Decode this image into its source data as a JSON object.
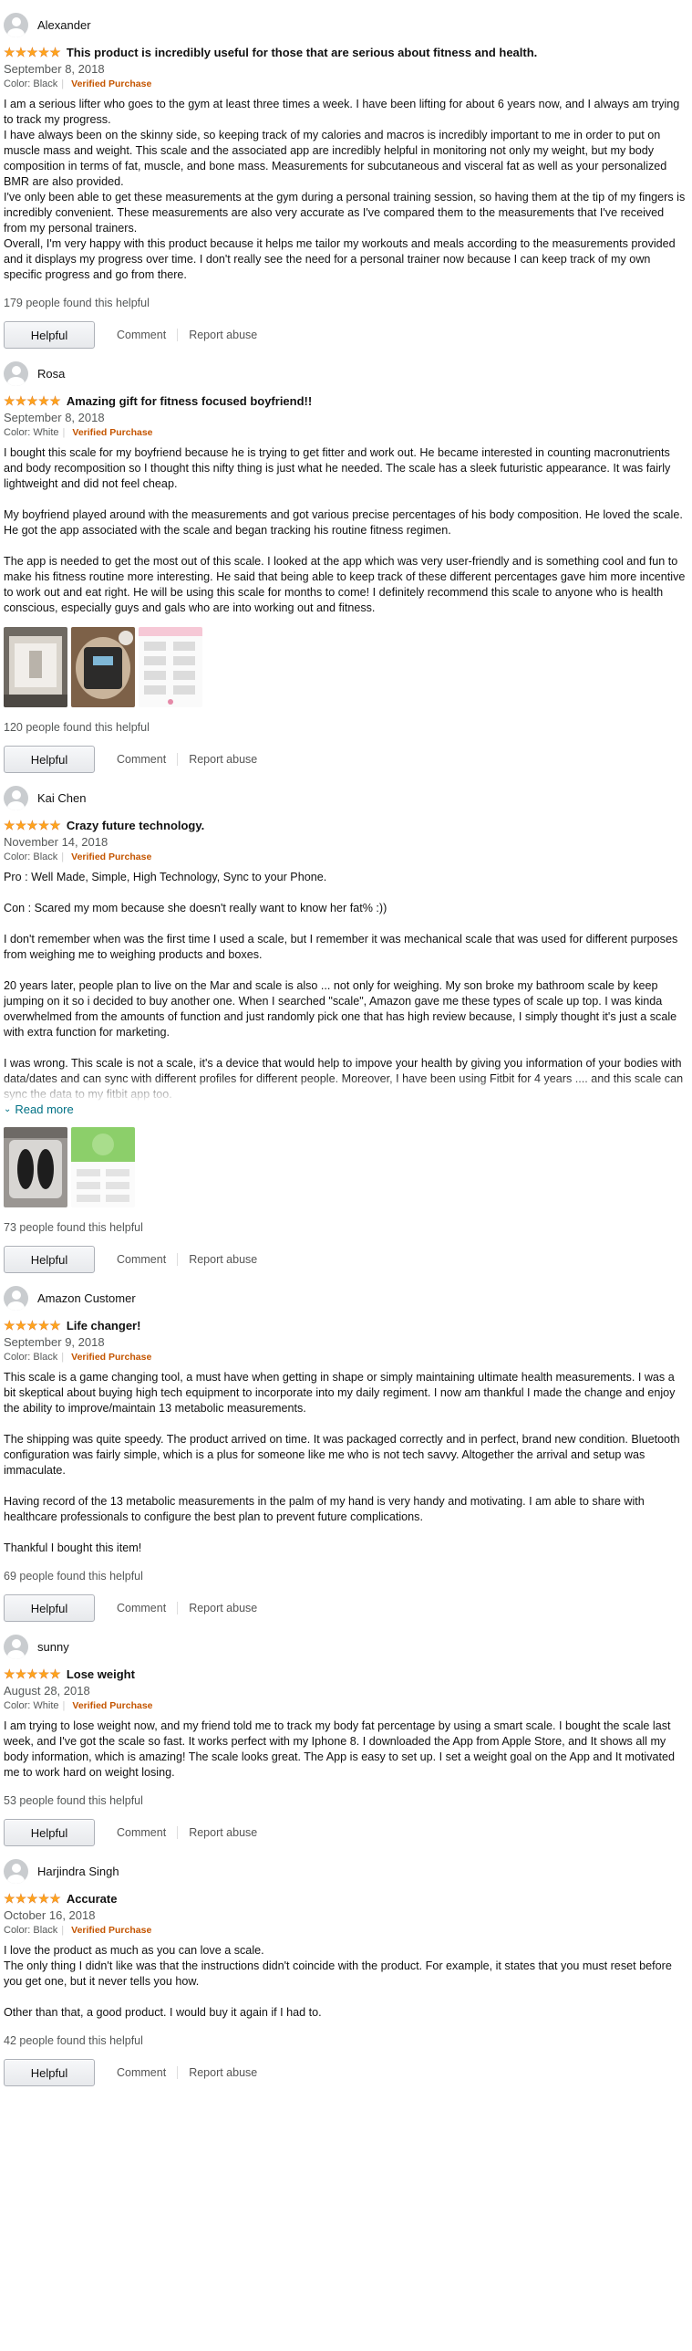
{
  "reviews": [
    {
      "name": "Alexander",
      "rating": 5,
      "title": "This product is incredibly useful for those that are serious about fitness and health.",
      "date": "September 8, 2018",
      "color": "Color: Black",
      "verified": "Verified Purchase",
      "body": "I am a serious lifter who goes to the gym at least three times a week. I have been lifting for about 6 years now, and I always am trying to track my progress.\nI have always been on the skinny side, so keeping track of my calories and macros is incredibly important to me in order to put on muscle mass and weight. This scale and the associated app are incredibly helpful in monitoring not only my weight, but my body composition in terms of fat, muscle, and bone mass. Measurements for subcutaneous and visceral fat as well as your personalized BMR are also provided.\nI've only been able to get these measurements at the gym during a personal training session, so having them at the tip of my fingers is incredibly convenient. These measurements are also very accurate as I've compared them to the measurements that I've received from my personal trainers.\nOverall, I'm very happy with this product because it helps me tailor my workouts and meals according to the measurements provided and it displays my progress over time. I don't really see the need for a personal trainer now because I can keep track of my own specific progress and go from there.",
      "helpful_count": "179 people found this helpful",
      "helpful_label": "Helpful",
      "comment_label": "Comment",
      "report_label": "Report abuse"
    },
    {
      "name": "Rosa",
      "rating": 5,
      "title": "Amazing gift for fitness focused boyfriend!!",
      "date": "September 8, 2018",
      "color": "Color: White",
      "verified": "Verified Purchase",
      "body": "I bought this scale for my boyfriend because he is trying to get fitter and work out. He became interested in counting macronutrients and body recomposition so I thought this nifty thing is just what he needed. The scale has a sleek futuristic appearance. It was fairly lightweight and did not feel cheap.\n\nMy boyfriend played around with the measurements and got various precise percentages of his body composition. He loved the scale. He got the app associated with the scale and began tracking his routine fitness regimen.\n\nThe app is needed to get the most out of this scale. I looked at the app which was very user-friendly and is something cool and fun to make his fitness routine more interesting. He said that being able to keep track of these different percentages gave him more incentive to work out and eat right. He will be using this scale for months to come! I definitely recommend this scale to anyone who is health conscious, especially guys and gals who are into working out and fitness.",
      "images": [
        "box-photo",
        "scale-photo",
        "app-screenshot"
      ],
      "helpful_count": "120 people found this helpful",
      "helpful_label": "Helpful",
      "comment_label": "Comment",
      "report_label": "Report abuse"
    },
    {
      "name": "Kai Chen",
      "rating": 5,
      "title": "Crazy future technology.",
      "date": "November 14, 2018",
      "color": "Color: Black",
      "verified": "Verified Purchase",
      "body": "Pro : Well Made, Simple, High Technology, Sync to your Phone.\n\nCon : Scared my mom because she doesn't really want to know her fat% :))\n\nI don't remember when was the first time I used a scale, but I remember it was mechanical scale that was used for different purposes from weighing me to weighing products and boxes.\n\n20 years later, people plan to live on the Mar and scale is also ... not only for weighing. My son broke my bathroom scale by keep jumping on it so i decided to buy another one. When I searched \"scale\", Amazon gave me these types of scale up top. I was kinda overwhelmed from the amounts of function and just randomly pick one that has high review because, I simply thought it's just a scale with extra function for marketing.\n\nI was wrong. This scale is not a scale, it's a device that would help to impove your health by giving you information of your bodies with data/dates and can sync with different profiles for different people. Moreover, I have been using Fitbit for 4 years .... and this scale can sync the data to my fitbit app too.",
      "read_more": "Read more",
      "images": [
        "feet-on-scale-photo",
        "app-screenshot-green"
      ],
      "helpful_count": "73 people found this helpful",
      "helpful_label": "Helpful",
      "comment_label": "Comment",
      "report_label": "Report abuse"
    },
    {
      "name": "Amazon Customer",
      "rating": 5,
      "title": "Life changer!",
      "date": "September 9, 2018",
      "color": "Color: Black",
      "verified": "Verified Purchase",
      "body": "This scale is a game changing tool, a must have when getting in shape or simply maintaining ultimate health measurements. I was a bit skeptical about buying high tech equipment to incorporate into my daily regiment. I now am thankful I made the change and enjoy the ability to improve/maintain 13 metabolic measurements.\n\nThe shipping was quite speedy. The product arrived on time. It was packaged correctly and in perfect, brand new condition. Bluetooth configuration was fairly simple, which is a plus for someone like me who is not tech savvy. Altogether the arrival and setup was immaculate.\n\nHaving record of the 13 metabolic measurements in the palm of my hand is very handy and motivating. I am able to share with healthcare professionals to configure the best plan to prevent future complications.\n\nThankful I bought this item!",
      "helpful_count": "69 people found this helpful",
      "helpful_label": "Helpful",
      "comment_label": "Comment",
      "report_label": "Report abuse"
    },
    {
      "name": "sunny",
      "rating": 5,
      "title": "Lose weight",
      "date": "August 28, 2018",
      "color": "Color: White",
      "verified": "Verified Purchase",
      "body": "I am trying to lose weight now, and my friend told me to track my body fat percentage by using a smart scale. I bought the scale last week, and I've got the scale so fast. It works perfect with my Iphone 8. I downloaded the App from Apple Store, and It shows all my body information, which is amazing! The scale looks great. The App is easy to set up. I set a weight goal on the App and It motivated me to work hard on weight losing.",
      "helpful_count": "53 people found this helpful",
      "helpful_label": "Helpful",
      "comment_label": "Comment",
      "report_label": "Report abuse"
    },
    {
      "name": "Harjindra Singh",
      "rating": 5,
      "title": "Accurate",
      "date": "October 16, 2018",
      "color": "Color: Black",
      "verified": "Verified Purchase",
      "body": "I love the product as much as you can love a scale.\nThe only thing I didn't like was that the instructions didn't coincide with the product. For example, it states that you must reset before you get one, but it never tells you how.\n\nOther than that, a good product. I would buy it again if I had to.",
      "helpful_count": "42 people found this helpful",
      "helpful_label": "Helpful",
      "comment_label": "Comment",
      "report_label": "Report abuse"
    }
  ]
}
